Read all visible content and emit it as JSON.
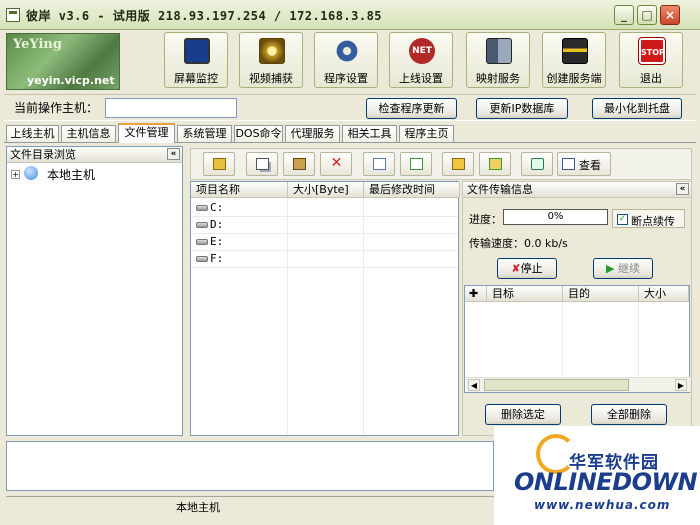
{
  "window": {
    "title": "彼岸 v3.6 - 试用版   218.93.197.254 / 172.168.3.85",
    "minimize_glyph": "_",
    "maximize_glyph": "□",
    "close_glyph": "×"
  },
  "logo": {
    "top_text": "YeYing",
    "url_text": "yeyin.vicp.net"
  },
  "toolbar": {
    "buttons": [
      {
        "label": "屏幕监控",
        "icon": "monitor-icon",
        "color": "#1a3c8c"
      },
      {
        "label": "视频捕获",
        "icon": "camera-icon",
        "color": "#c49a20"
      },
      {
        "label": "程序设置",
        "icon": "gear-icon",
        "color": "#355c9e"
      },
      {
        "label": "上线设置",
        "icon": "net-icon",
        "color": "#b02a2a"
      },
      {
        "label": "映射服务",
        "icon": "server-icon",
        "color": "#4a5a70"
      },
      {
        "label": "创建服务端",
        "icon": "build-icon",
        "color": "#2a2a2a"
      },
      {
        "label": "退出",
        "icon": "stop-icon",
        "color": "#d01818"
      }
    ]
  },
  "hostbar": {
    "label": "当前操作主机：",
    "input_value": "",
    "check_update": "检查程序更新",
    "update_ip": "更新IP数据库",
    "minimize_tray": "最小化到托盘"
  },
  "tabs": [
    {
      "label": "上线主机",
      "active": false
    },
    {
      "label": "主机信息",
      "active": false
    },
    {
      "label": "文件管理",
      "active": true
    },
    {
      "label": "系统管理",
      "active": false
    },
    {
      "label": "DOS命令",
      "active": false
    },
    {
      "label": "代理服务",
      "active": false
    },
    {
      "label": "相关工具",
      "active": false
    },
    {
      "label": "程序主页",
      "active": false
    }
  ],
  "left_pane": {
    "header": "文件目录浏览",
    "collapse": "«",
    "tree_expand": "+",
    "tree_root": "本地主机"
  },
  "file_toolbar": {
    "view_label": "查看"
  },
  "file_list": {
    "columns": [
      "项目名称",
      "大小[Byte]",
      "最后修改时间"
    ],
    "rows": [
      {
        "name": "C:",
        "size": "",
        "modified": ""
      },
      {
        "name": "D:",
        "size": "",
        "modified": ""
      },
      {
        "name": "E:",
        "size": "",
        "modified": ""
      },
      {
        "name": "F:",
        "size": "",
        "modified": ""
      }
    ]
  },
  "transfer": {
    "header": "文件传输信息",
    "collapse": "«",
    "progress_label": "进度：",
    "progress_value": "0%",
    "resume_label": "断点续传",
    "resume_checked": true,
    "speed_label": "传输速度：0.0 kb/s",
    "stop_label": "停止",
    "continue_label": "继续",
    "columns": [
      "目标",
      "目的",
      "大小"
    ],
    "delete_selected": "删除选定",
    "delete_all": "全部删除"
  },
  "status": {
    "text": "本地主机"
  },
  "watermark": {
    "cn": "华军软件园",
    "logo": "ONLINEDOWN",
    "url": "www.newhua.com"
  }
}
